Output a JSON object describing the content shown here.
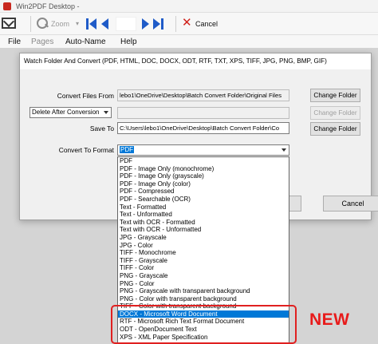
{
  "window": {
    "title": "Win2PDF Desktop -"
  },
  "toolbar": {
    "zoom_label": "Zoom",
    "cancel_label": "Cancel"
  },
  "menubar": {
    "items": [
      "File",
      "Pages",
      "Auto-Name",
      "Help"
    ]
  },
  "dialog": {
    "title": "Watch Folder And Convert (PDF, HTML, DOC, DOCX, ODT, RTF, TXT, XPS, TIFF, JPG, PNG, BMP, GIF)",
    "convert_from_label": "Convert Files From",
    "convert_from_value": "lebo1\\OneDrive\\Desktop\\Batch Convert Folder\\Original Files",
    "after_conversion_value": "Delete After Conversion",
    "save_to_label": "Save To",
    "save_to_value": "C:\\Users\\lebo1\\OneDrive\\Desktop\\Batch Convert Folder\\Co",
    "format_label": "Convert To Format",
    "format_value": "PDF",
    "change_folder_label": "Change Folder",
    "cancel_label": "Cancel"
  },
  "format_options": [
    "PDF",
    "PDF - Image Only (monochrome)",
    "PDF - Image Only (grayscale)",
    "PDF - Image Only (color)",
    "PDF - Compressed",
    "PDF - Searchable (OCR)",
    "Text - Formatted",
    "Text - Unformatted",
    "Text with OCR - Formatted",
    "Text with OCR - Unformatted",
    "JPG - Grayscale",
    "JPG - Color",
    "TIFF - Monochrome",
    "TIFF - Grayscale",
    "TIFF - Color",
    "PNG - Grayscale",
    "PNG - Color",
    "PNG - Grayscale with transparent background",
    "PNG - Color with transparent background",
    "TIFF - Color with transparent background",
    "DOCX - Microsoft Word Document",
    "RTF - Microsoft Rich Text Format Document",
    "ODT - OpenDocument Text",
    "XPS - XML Paper Specification"
  ],
  "selected_option_index": 20,
  "annotation": {
    "label": "NEW",
    "color": "#e81b1b"
  },
  "colors": {
    "selection": "#0078d7",
    "nav": "#1f5bc8",
    "cancel": "#d0201a"
  }
}
